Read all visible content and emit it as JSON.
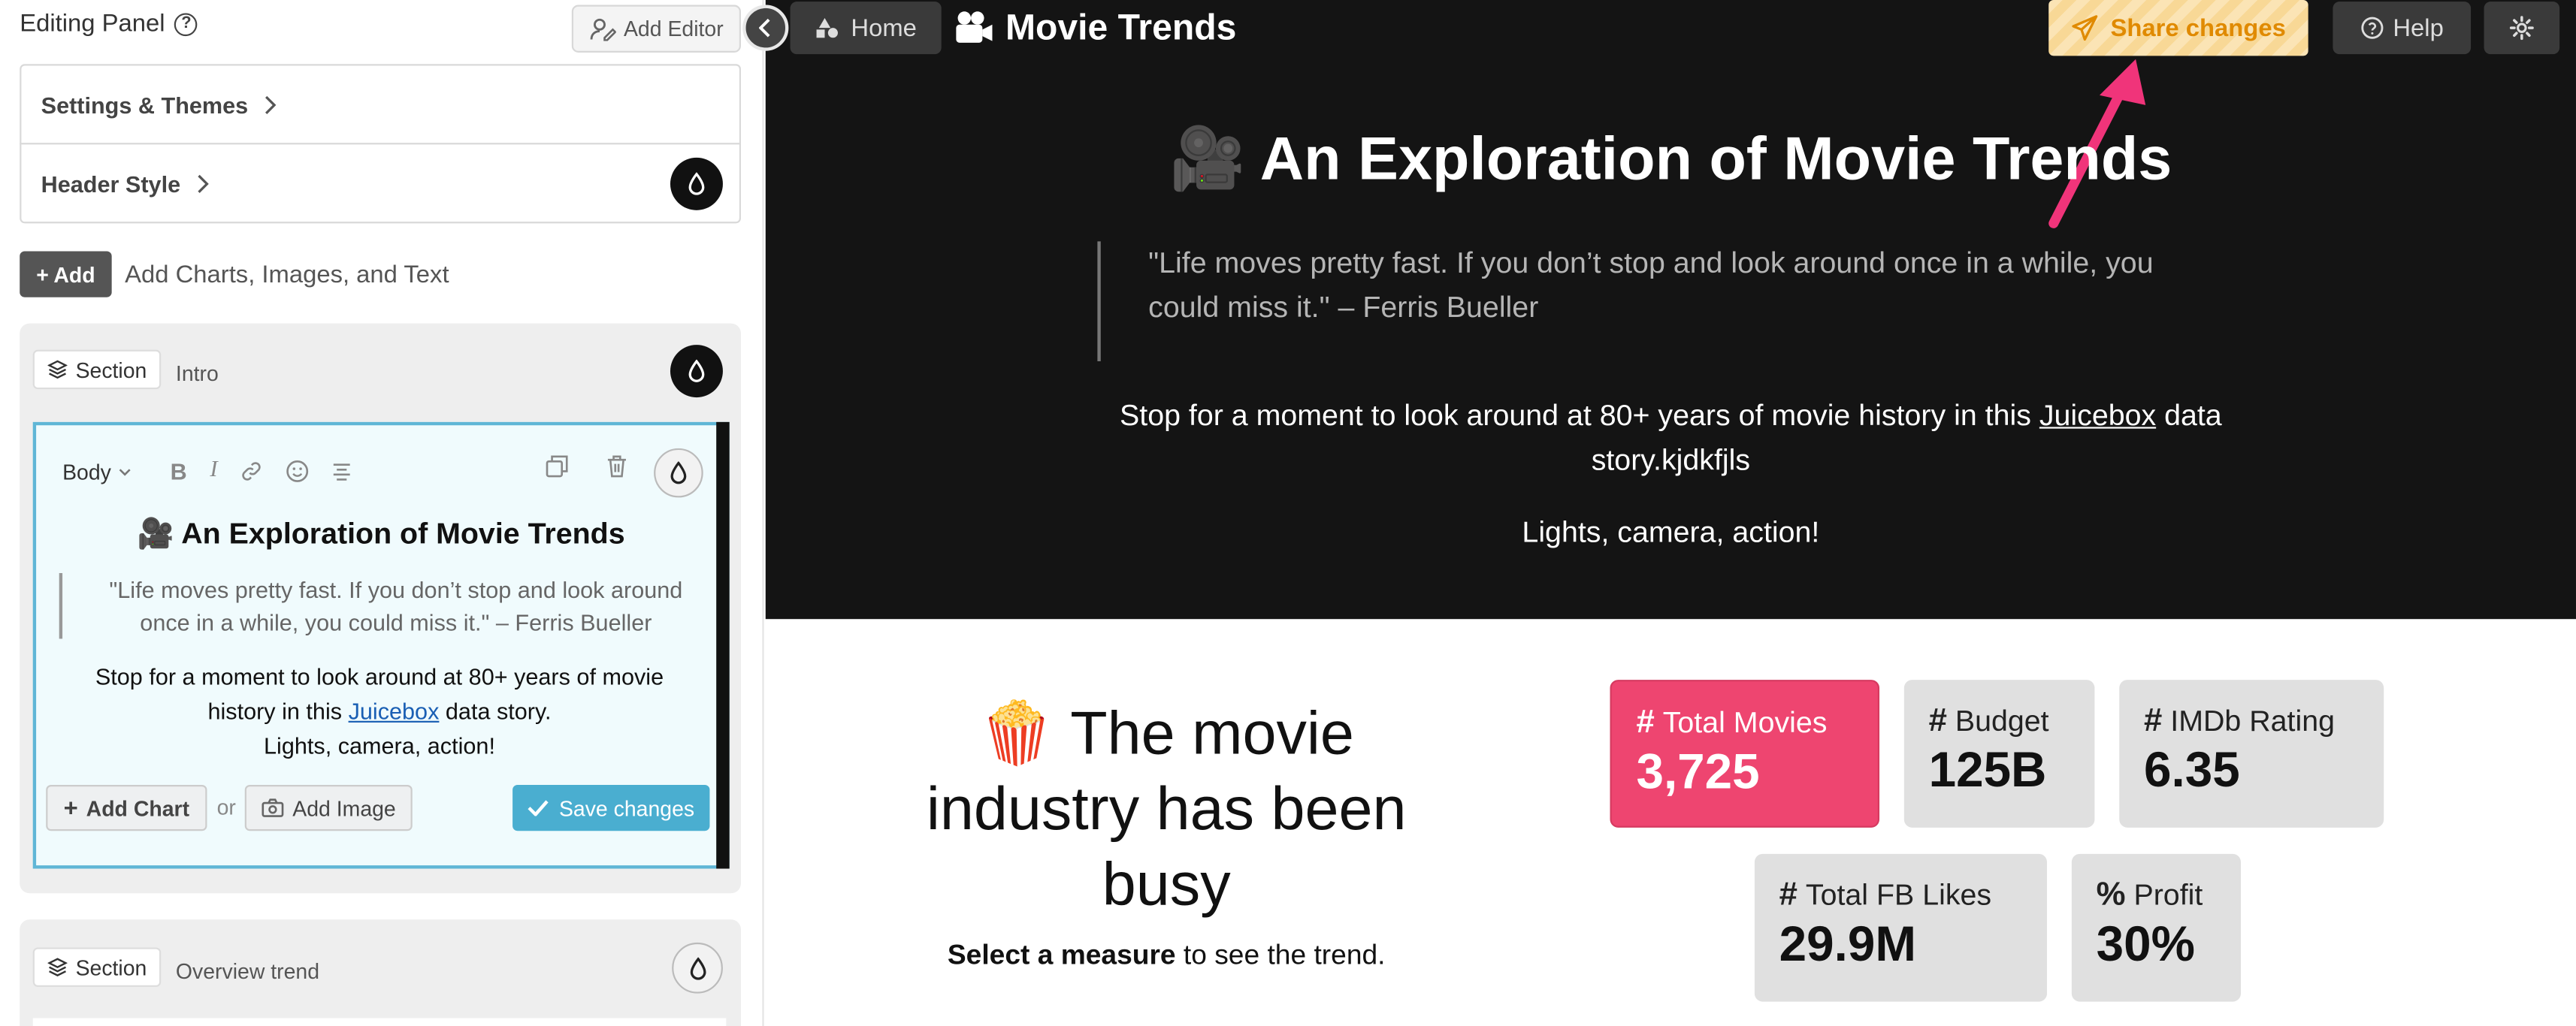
{
  "panel": {
    "title": "Editing Panel",
    "add_editor_label": "Add Editor",
    "settings_label": "Settings & Themes",
    "header_style_label": "Header Style",
    "add_label": "Add",
    "add_description": "Add Charts, Images, and Text",
    "section1": {
      "tag": "Section",
      "name": "Intro"
    },
    "section2": {
      "tag": "Section",
      "name": "Overview trend"
    },
    "editor": {
      "style_select": "Body",
      "title": "🎥 An Exploration of Movie Trends",
      "quote": "\"Life moves pretty fast. If you don’t stop and look around once in a while, you could miss it.\" – Ferris Bueller",
      "body_pre": "Stop for a moment to look around at 80+ years of movie history in this ",
      "body_link": "Juicebox",
      "body_post": " data story.",
      "body_line2": "Lights, camera, action!",
      "add_chart_label": "Add Chart",
      "or_label": "or",
      "add_image_label": "Add Image",
      "save_label": "Save changes"
    }
  },
  "topbar": {
    "home_label": "Home",
    "app_title": "Movie Trends",
    "share_label": "Share changes",
    "help_label": "Help"
  },
  "hero": {
    "title": "🎥 An Exploration of Movie Trends",
    "quote": "\"Life moves pretty fast. If you don’t stop and look around once in a while, you could miss it.\" – Ferris Bueller",
    "body_pre": "Stop for a moment to look around at 80+ years of movie history in this ",
    "body_link": "Juicebox",
    "body_post": " data story.kjdkfjls",
    "lights": "Lights, camera, action!"
  },
  "overview": {
    "heading": "🍿 The movie industry has been busy",
    "sub_bold": "Select a measure",
    "sub_rest": " to see the trend."
  },
  "metrics": [
    {
      "symbol": "#",
      "label": "Total Movies",
      "value": "3,725",
      "active": true
    },
    {
      "symbol": "#",
      "label": "Budget",
      "value": "125B",
      "active": false
    },
    {
      "symbol": "#",
      "label": "IMDb Rating",
      "value": "6.35",
      "active": false
    },
    {
      "symbol": "#",
      "label": "Total FB Likes",
      "value": "29.9M",
      "active": false
    },
    {
      "symbol": "%",
      "label": "Profit",
      "value": "30%",
      "active": false
    }
  ],
  "colors": {
    "accent_pink": "#ee4570",
    "hero_bg": "#141414",
    "editor_border": "#5fb6d6",
    "save_button": "#4aaed0",
    "share_text": "#e08a00"
  }
}
